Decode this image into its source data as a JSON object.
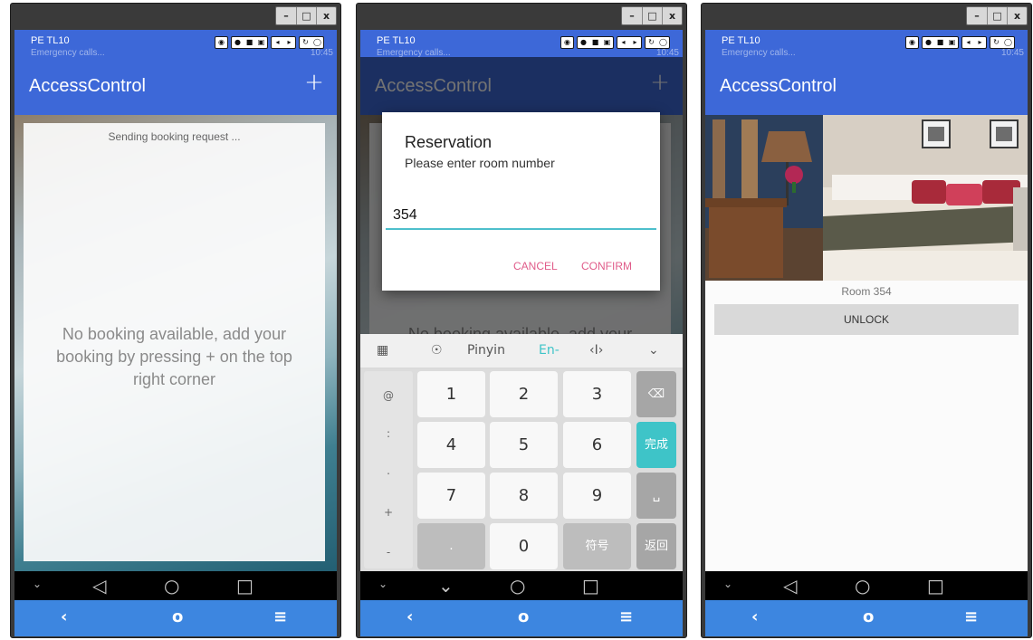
{
  "window": {
    "min": "–",
    "max": "□",
    "close": "x"
  },
  "emulator": {
    "device_name": "PE TL10",
    "ghost_status": "Emergency calls...",
    "ghost_time": "10:45",
    "tool_icons": [
      "headset-icon",
      "record-icon",
      "camera-icon",
      "volume-down-icon",
      "volume-up-icon",
      "rotate-icon",
      "power-icon"
    ]
  },
  "app": {
    "title": "AccessControl",
    "add_icon": "+"
  },
  "screen1": {
    "sending": "Sending booking request ...",
    "empty_message": "No booking available, add your booking by pressing + on the top right corner"
  },
  "screen2": {
    "dialog_title": "Reservation",
    "dialog_message": "Please enter room number",
    "input_value": "354",
    "cancel": "CANCEL",
    "confirm": "CONFIRM",
    "keyboard_top": [
      "Pinyin",
      "En-"
    ],
    "symbols": [
      "@",
      ":",
      ".",
      "+",
      "-"
    ],
    "digits": [
      "1",
      "2",
      "3",
      "4",
      "5",
      "6",
      "7",
      "8",
      "9",
      "0"
    ],
    "symbol_key": "符号",
    "done_key": "完成",
    "back_key": "返回",
    "dot_key": "."
  },
  "screen3": {
    "room_label": "Room 354",
    "unlock": "UNLOCK"
  },
  "nav": {
    "back": "◁",
    "home": "○",
    "recents": "□",
    "chevron": "⌄"
  },
  "toolbar": {
    "back": "‹",
    "home": "o",
    "menu": "≡"
  },
  "colors": {
    "app_bar": "#3d68d8",
    "bottom_toolbar": "#3d86e0",
    "accent_pink": "#e05c8a",
    "input_line": "#4dbfcc",
    "done_key": "#3ec4c8"
  }
}
